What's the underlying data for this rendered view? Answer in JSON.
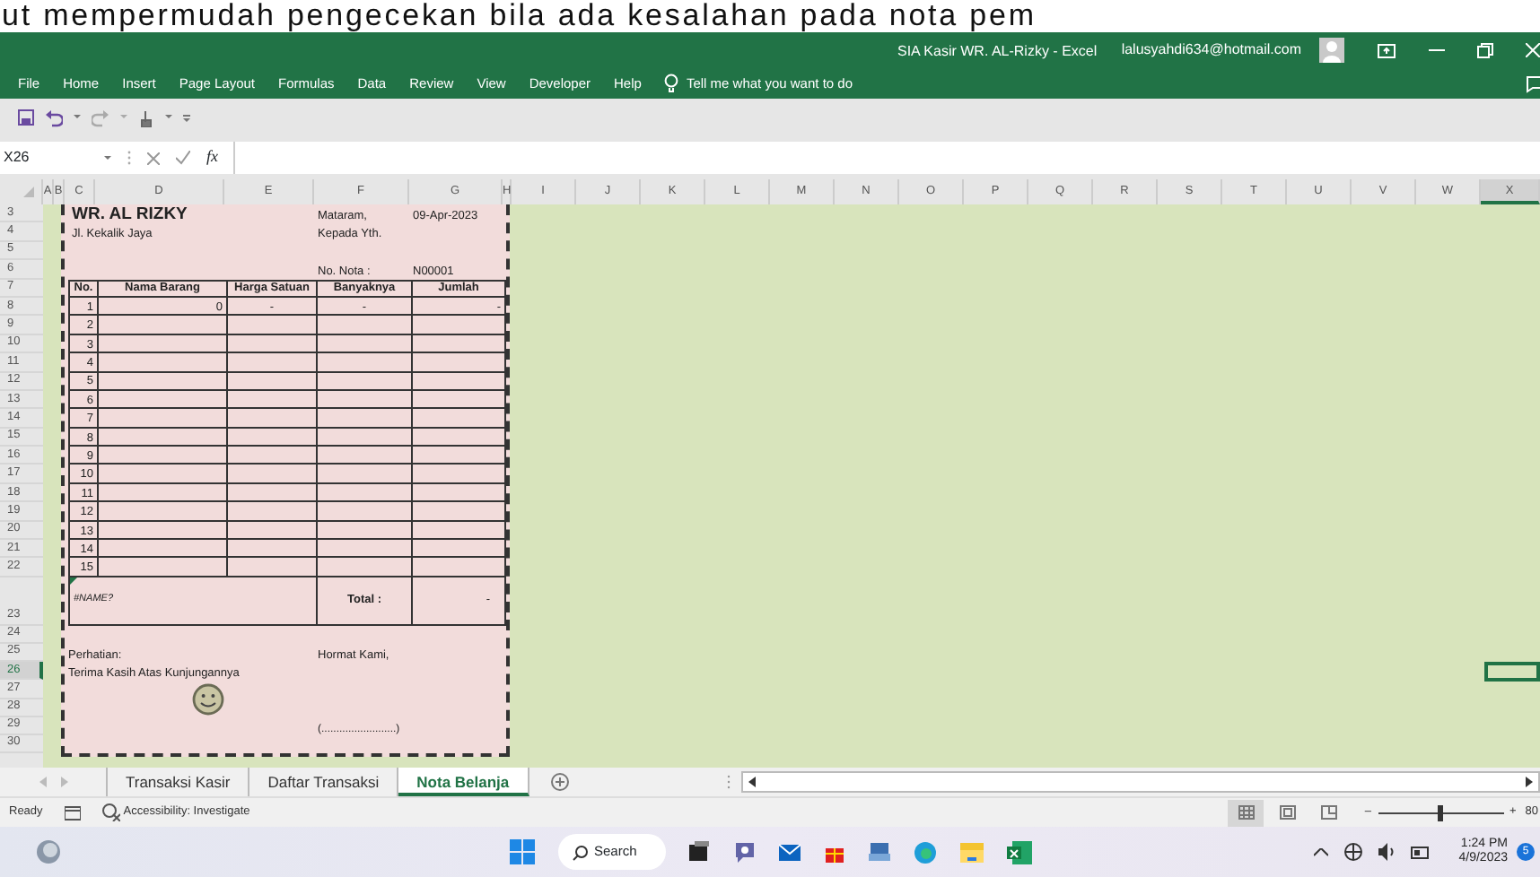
{
  "caption": "ut mempermudah pengecekan bila ada kesalahan pada nota pem",
  "window": {
    "title": "SIA Kasir WR. AL-Rizky  -  Excel",
    "account": "lalusyahdi634@hotmail.com"
  },
  "ribbon_tabs": [
    "File",
    "Home",
    "Insert",
    "Page Layout",
    "Formulas",
    "Data",
    "Review",
    "View",
    "Developer",
    "Help"
  ],
  "tell_me": "Tell me what you want to do",
  "formula_bar": {
    "name_box": "X26",
    "function_label": "fx"
  },
  "column_headers": [
    {
      "label": "A",
      "selected": false
    },
    {
      "label": "B",
      "selected": false
    },
    {
      "label": "C",
      "selected": false
    },
    {
      "label": "D",
      "selected": false
    },
    {
      "label": "E",
      "selected": false
    },
    {
      "label": "F",
      "selected": false
    },
    {
      "label": "G",
      "selected": false
    },
    {
      "label": "H",
      "selected": false
    },
    {
      "label": "I",
      "selected": false
    },
    {
      "label": "J",
      "selected": false
    },
    {
      "label": "K",
      "selected": false
    },
    {
      "label": "L",
      "selected": false
    },
    {
      "label": "M",
      "selected": false
    },
    {
      "label": "N",
      "selected": false
    },
    {
      "label": "O",
      "selected": false
    },
    {
      "label": "P",
      "selected": false
    },
    {
      "label": "Q",
      "selected": false
    },
    {
      "label": "R",
      "selected": false
    },
    {
      "label": "S",
      "selected": false
    },
    {
      "label": "T",
      "selected": false
    },
    {
      "label": "U",
      "selected": false
    },
    {
      "label": "V",
      "selected": false
    },
    {
      "label": "W",
      "selected": false
    },
    {
      "label": "X",
      "selected": true
    }
  ],
  "row_headers": [
    {
      "label": "3",
      "selected": false
    },
    {
      "label": "4",
      "selected": false
    },
    {
      "label": "5",
      "selected": false
    },
    {
      "label": "6",
      "selected": false
    },
    {
      "label": "7",
      "selected": false
    },
    {
      "label": "8",
      "selected": false
    },
    {
      "label": "9",
      "selected": false
    },
    {
      "label": "10",
      "selected": false
    },
    {
      "label": "11",
      "selected": false
    },
    {
      "label": "12",
      "selected": false
    },
    {
      "label": "13",
      "selected": false
    },
    {
      "label": "14",
      "selected": false
    },
    {
      "label": "15",
      "selected": false
    },
    {
      "label": "16",
      "selected": false
    },
    {
      "label": "17",
      "selected": false
    },
    {
      "label": "18",
      "selected": false
    },
    {
      "label": "19",
      "selected": false
    },
    {
      "label": "20",
      "selected": false
    },
    {
      "label": "21",
      "selected": false
    },
    {
      "label": "22",
      "selected": false
    },
    {
      "label": "23",
      "selected": false
    },
    {
      "label": "24",
      "selected": false
    },
    {
      "label": "25",
      "selected": false
    },
    {
      "label": "26",
      "selected": true
    },
    {
      "label": "27",
      "selected": false
    },
    {
      "label": "28",
      "selected": false
    },
    {
      "label": "29",
      "selected": false
    },
    {
      "label": "30",
      "selected": false
    }
  ],
  "invoice": {
    "store_name": "WR. AL RIZKY",
    "address": "Jl. Kekalik Jaya",
    "date_label": "Mataram,",
    "date": "09-Apr-2023",
    "recipient": "Kepada Yth.",
    "nota_label": "No. Nota :",
    "nota_number": "N00001",
    "columns": [
      "No.",
      "Nama Barang",
      "Harga Satuan",
      "Banyaknya",
      "Jumlah"
    ],
    "rows": [
      {
        "no": "1",
        "nama_barang": "0",
        "harga_satuan": "-",
        "banyaknya": "-",
        "jumlah": "-"
      },
      {
        "no": "2"
      },
      {
        "no": "3"
      },
      {
        "no": "4"
      },
      {
        "no": "5"
      },
      {
        "no": "6"
      },
      {
        "no": "7"
      },
      {
        "no": "8"
      },
      {
        "no": "9"
      },
      {
        "no": "10"
      },
      {
        "no": "11"
      },
      {
        "no": "12"
      },
      {
        "no": "13"
      },
      {
        "no": "14"
      },
      {
        "no": "15"
      }
    ],
    "note_cell": "#NAME?",
    "total_label": "Total :",
    "total": "-",
    "notice_label": "Perhatian:",
    "thanks": "Terima Kasih Atas Kunjungannya",
    "closing": "Hormat Kami,",
    "signature": "(.........................)"
  },
  "sheet_tabs": [
    {
      "label": "Transaksi Kasir",
      "selected": false
    },
    {
      "label": "Daftar Transaksi",
      "selected": false
    },
    {
      "label": "Nota Belanja",
      "selected": true
    }
  ],
  "status_bar": {
    "ready": "Ready",
    "accessibility": "Accessibility: Investigate",
    "view_modes": [
      {
        "selected": true
      },
      {
        "selected": false
      },
      {
        "selected": false
      }
    ],
    "zoom_out": "–",
    "zoom_slider": {
      "level": 0.47
    },
    "zoom_in": "+",
    "zoom": "80"
  },
  "taskbar": {
    "search": "Search",
    "time": "1:24 PM",
    "date": "4/9/2023",
    "notification_count": "5"
  }
}
